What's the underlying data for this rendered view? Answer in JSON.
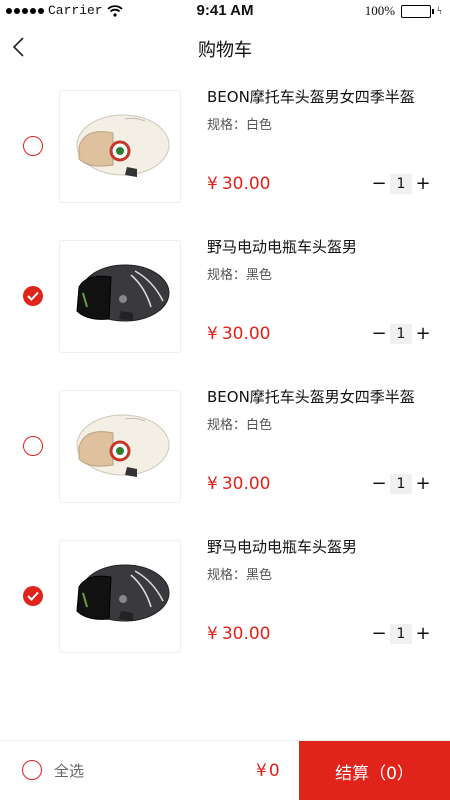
{
  "status_bar": {
    "carrier": "Carrier",
    "time": "9:41 AM",
    "battery": "100%",
    "battery_level": 1.0
  },
  "nav": {
    "title": "购物车"
  },
  "currency": "¥",
  "spec_label": "规格：",
  "cart": [
    {
      "name": "BEON摩托车头盔男女四季半盔",
      "spec": "白色",
      "price": "30.00",
      "qty": "1",
      "checked": false,
      "helmet": "white"
    },
    {
      "name": "野马电动电瓶车头盔男",
      "spec": "黑色",
      "price": "30.00",
      "qty": "1",
      "checked": true,
      "helmet": "black"
    },
    {
      "name": "BEON摩托车头盔男女四季半盔",
      "spec": "白色",
      "price": "30.00",
      "qty": "1",
      "checked": false,
      "helmet": "white"
    },
    {
      "name": "野马电动电瓶车头盔男",
      "spec": "黑色",
      "price": "30.00",
      "qty": "1",
      "checked": true,
      "helmet": "black"
    }
  ],
  "stepper": {
    "minus": "−",
    "plus": "+"
  },
  "bottom": {
    "select_all": "全选",
    "total": "0",
    "checkout": "结算（0）"
  },
  "colors": {
    "accent": "#e0231b"
  },
  "icons": [
    "signal-icon",
    "wifi-icon",
    "battery-icon",
    "back-chevron-icon",
    "checkmark-icon",
    "helmet-image"
  ]
}
